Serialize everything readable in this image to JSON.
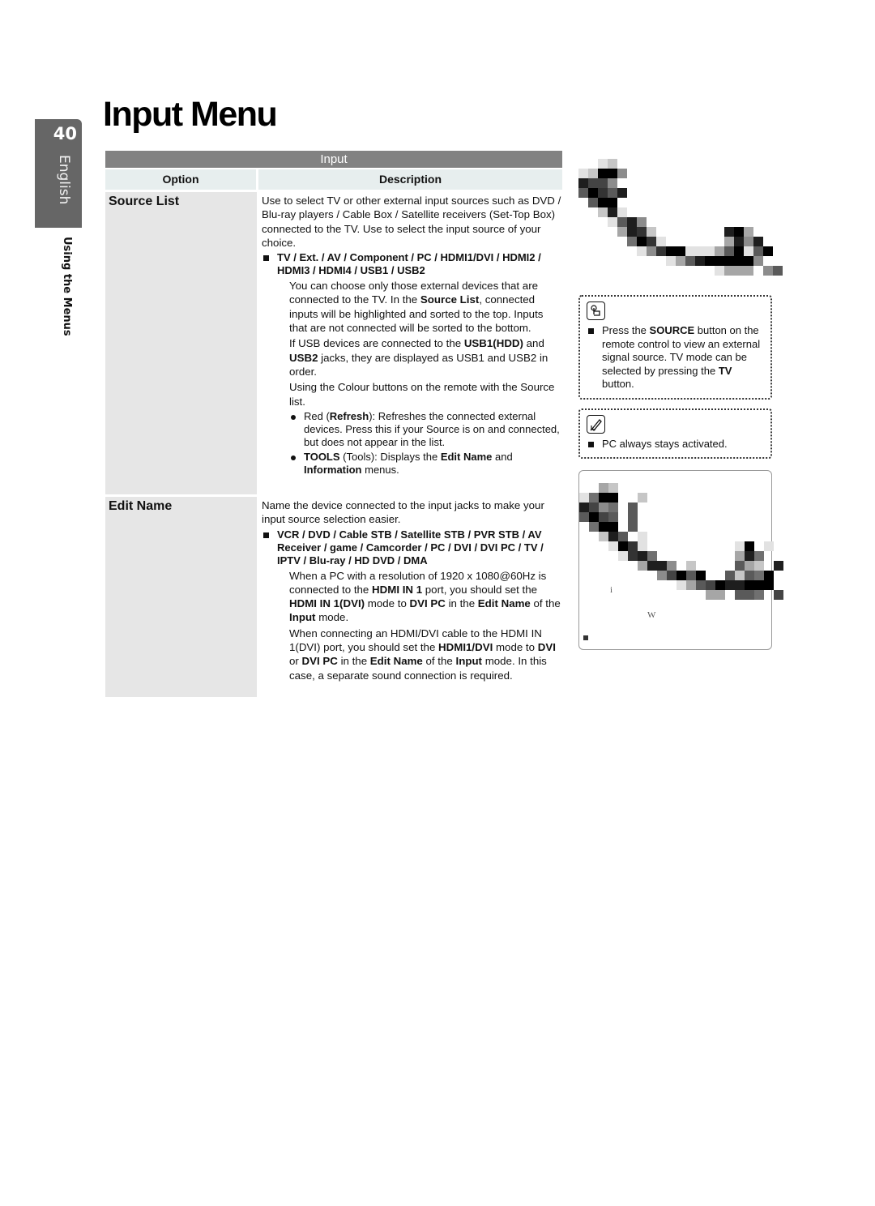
{
  "page": {
    "number": "40",
    "language": "English",
    "section": "Using the Menus",
    "title": "Input Menu"
  },
  "table": {
    "caption": "Input",
    "col_option": "Option",
    "col_description": "Description",
    "rows": [
      {
        "option": "Source List",
        "intro": "Use to select TV or other external input sources such as DVD / Blu-ray players / Cable Box / Satellite receivers (Set-Top Box) connected to the TV. Use to select the input source of your choice.",
        "list_item": "TV / Ext. / AV / Component / PC / HDMI1/DVI / HDMI2 / HDMI3 / HDMI4 / USB1 / USB2",
        "para1": {
          "a": "You can choose only those external devices that are connected to the TV. In the ",
          "b": "Source List",
          "c": ", connected inputs will be highlighted and sorted to the top. Inputs that are not connected will be sorted to the bottom."
        },
        "para2": {
          "a": "If USB devices are connected to the ",
          "b": "USB1(HDD)",
          "c": " and ",
          "d": "USB2",
          "e": " jacks, they are displayed as USB1 and USB2 in order."
        },
        "para3": "Using the Colour buttons on the remote with the Source list.",
        "bullets": [
          {
            "a": "Red (",
            "b": "Refresh",
            "c": "): Refreshes the connected external devices. Press this if your Source is on and connected, but does not appear in the list."
          },
          {
            "a": "TOOLS",
            "b": " (Tools): Displays the ",
            "c": "Edit Name",
            "d": " and ",
            "e": "Information",
            "f": " menus."
          }
        ]
      },
      {
        "option": "Edit Name",
        "intro": "Name the device connected to the input jacks to make your input source selection easier.",
        "list_item": "VCR / DVD / Cable STB / Satellite STB / PVR STB / AV Receiver / game / Camcorder / PC / DVI / DVI PC / TV / IPTV / Blu-ray / HD DVD / DMA",
        "para1": {
          "a": "When a PC with a resolution of 1920 x 1080@60Hz is connected to the ",
          "b": "HDMI IN 1",
          "c": " port, you should set the ",
          "d": "HDMI IN 1(DVI)",
          "e": " mode to ",
          "f": "DVI PC",
          "g": " in the ",
          "h": "Edit Name",
          "i": " of the ",
          "j": "Input",
          "k": " mode."
        },
        "para2": {
          "a": "When connecting an HDMI/DVI cable to the HDMI IN 1(DVI) port, you should set the ",
          "b": "HDMI1/DVI",
          "c": " mode to ",
          "d": "DVI",
          "e": " or ",
          "f": "DVI PC",
          "g": " in the ",
          "h": "Edit Name",
          "i": " of the ",
          "j": "Input",
          "k": " mode. In this case, a separate sound connection is required."
        }
      }
    ]
  },
  "notes": [
    {
      "icon": "hand-pointer-icon",
      "a": "Press the ",
      "b": "SOURCE",
      "c": " button on the remote control to view an external signal source. TV mode can be selected by pressing the ",
      "d": "TV",
      "e": " button."
    },
    {
      "icon": "note-pencil-icon",
      "text": "PC always stays activated."
    }
  ],
  "image_artifacts": {
    "labels": [
      "i",
      "W"
    ]
  }
}
